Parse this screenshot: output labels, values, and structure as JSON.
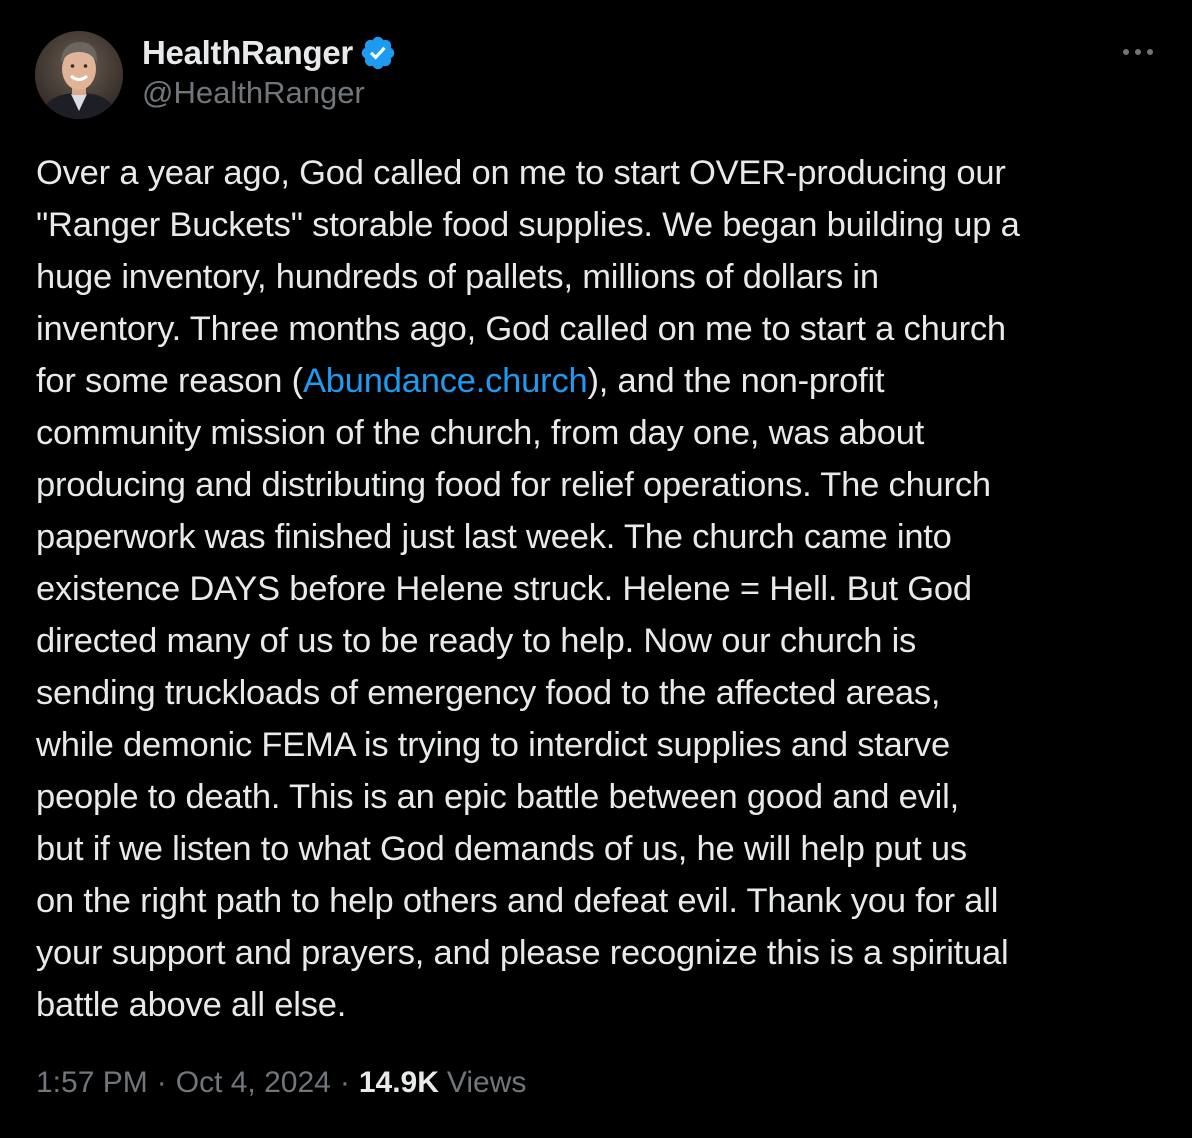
{
  "tweet": {
    "author": {
      "display_name": "HealthRanger",
      "handle": "@HealthRanger",
      "verified": true,
      "verified_color": "#1d9bf0"
    },
    "menu_icon": "more-horizontal-icon",
    "text": {
      "line_01": "Over a year ago, God called on me to start OVER-producing our",
      "line_02": "\"Ranger Buckets\" storable food supplies. We began building up a",
      "line_03": "huge inventory, hundreds of pallets, millions of dollars in",
      "line_04": "inventory. Three months ago, God called on me to start a church",
      "line_05_before": "for some reason (",
      "line_05_link": "Abundance.church",
      "line_05_after": "), and the non-profit",
      "line_06": "community mission of the church, from day one, was about",
      "line_07": "producing and distributing food for relief operations. The church",
      "line_08": "paperwork was finished just last week. The church came into",
      "line_09": "existence DAYS before Helene struck. Helene = Hell. But God",
      "line_10": "directed many of us to be ready to help. Now our church is",
      "line_11": "sending truckloads of emergency food to the affected areas,",
      "line_12": "while demonic FEMA is trying to interdict supplies and starve",
      "line_13": "people to death. This is an epic battle between good and evil,",
      "line_14": "but if we listen to what God demands of us, he will help put us",
      "line_15": "on the right path to help others and defeat evil. Thank you for all",
      "line_16": "your support and prayers, and please recognize this is a spiritual",
      "line_17": "battle above all else."
    },
    "meta": {
      "time": "1:57 PM",
      "separator": "·",
      "date": "Oct 4, 2024",
      "views_count": "14.9K",
      "views_label": "Views"
    }
  },
  "colors": {
    "background": "#000000",
    "text_primary": "#e7e9ea",
    "text_secondary": "#71767b",
    "link": "#1d9bf0"
  }
}
